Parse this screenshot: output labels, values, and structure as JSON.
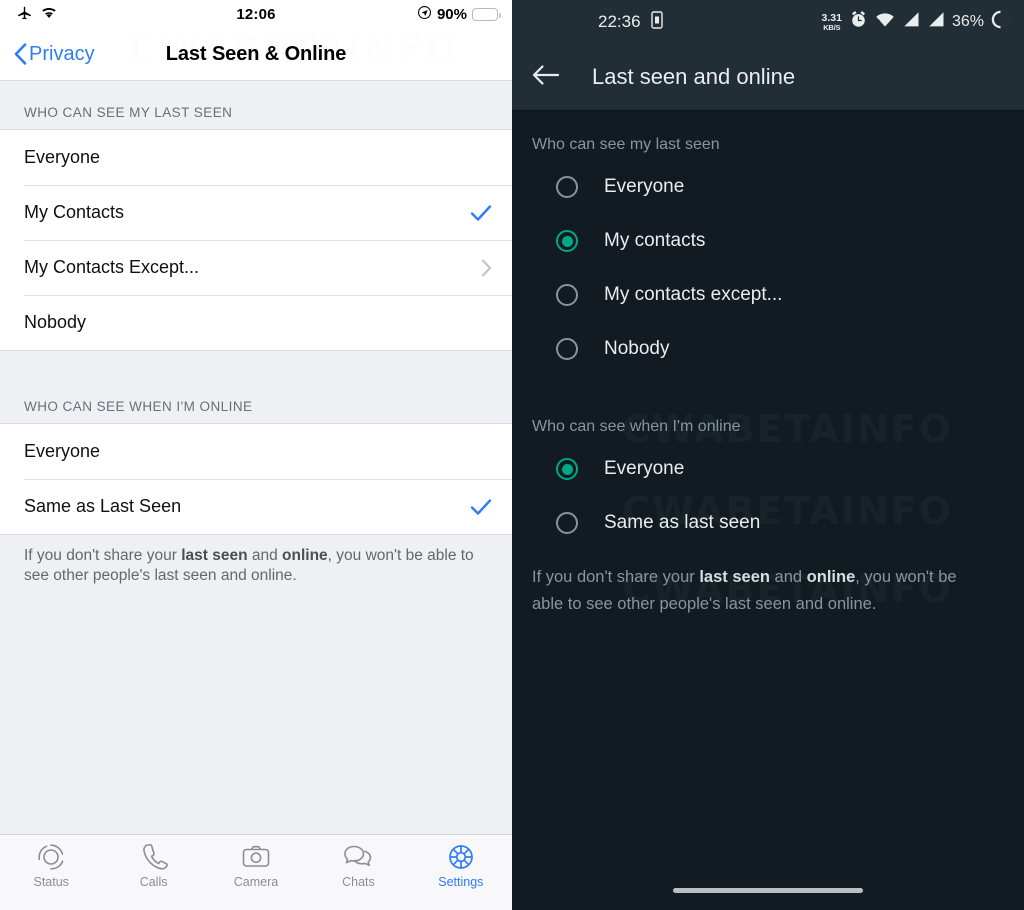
{
  "watermark": {
    "text": "CWABETAINFO"
  },
  "ios": {
    "status_bar": {
      "airplane_icon": "airplane-icon",
      "wifi_icon": "wifi-icon",
      "time": "12:06",
      "location_icon": "location-arrow-icon",
      "battery_percent": "90%",
      "battery_level": 90
    },
    "nav": {
      "back_label": "Privacy",
      "title": "Last Seen & Online"
    },
    "sections": [
      {
        "header": "WHO CAN SEE MY LAST SEEN",
        "rows": [
          {
            "label": "Everyone",
            "trailing": "none"
          },
          {
            "label": "My Contacts",
            "trailing": "check"
          },
          {
            "label": "My Contacts Except...",
            "trailing": "chevron"
          },
          {
            "label": "Nobody",
            "trailing": "none"
          }
        ]
      },
      {
        "header": "WHO CAN SEE WHEN I'M ONLINE",
        "rows": [
          {
            "label": "Everyone",
            "trailing": "none"
          },
          {
            "label": "Same as Last Seen",
            "trailing": "check"
          }
        ]
      }
    ],
    "footer": {
      "part1": "If you don't share your ",
      "bold1": "last seen",
      "part2": " and ",
      "bold2": "online",
      "part3": ", you won't be able to see other people's last seen and online."
    },
    "tabbar": [
      {
        "label": "Status",
        "icon": "status-rings-icon",
        "active": false
      },
      {
        "label": "Calls",
        "icon": "phone-icon",
        "active": false
      },
      {
        "label": "Camera",
        "icon": "camera-icon",
        "active": false
      },
      {
        "label": "Chats",
        "icon": "chat-bubbles-icon",
        "active": false
      },
      {
        "label": "Settings",
        "icon": "gear-icon",
        "active": true
      }
    ],
    "colors": {
      "accent": "#2f7cf6",
      "section_bg": "#eff0f4",
      "battery": "#fccc19"
    }
  },
  "android": {
    "status_bar": {
      "time": "22:36",
      "device_icon": "device-icon",
      "net_speed_value": "3.31",
      "net_speed_unit": "KB/S",
      "alarm_icon": "alarm-clock-icon",
      "wifi_icon": "wifi-icon",
      "signal_icon_1": "signal-bars-icon",
      "signal_icon_2": "signal-bars-icon",
      "battery_percent": "36%",
      "battery_icon": "battery-circle-icon"
    },
    "appbar": {
      "back_icon": "back-arrow-icon",
      "title": "Last seen and online"
    },
    "sections": [
      {
        "header": "Who can see my last seen",
        "rows": [
          {
            "label": "Everyone",
            "selected": false
          },
          {
            "label": "My contacts",
            "selected": true
          },
          {
            "label": "My contacts except...",
            "selected": false
          },
          {
            "label": "Nobody",
            "selected": false
          }
        ]
      },
      {
        "header": "Who can see when I'm online",
        "rows": [
          {
            "label": "Everyone",
            "selected": true
          },
          {
            "label": "Same as last seen",
            "selected": false
          }
        ]
      }
    ],
    "footer": {
      "part1": "If you don't share your ",
      "bold1": "last seen",
      "part2": " and ",
      "bold2": "online",
      "part3": ", you won't be able to see other people's last seen and online."
    },
    "colors": {
      "accent": "#00a884",
      "appbar_bg": "#222e35",
      "body_bg": "#111b21"
    }
  }
}
